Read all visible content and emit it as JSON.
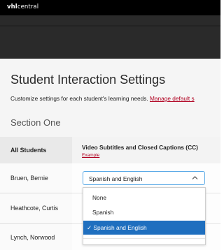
{
  "brand": {
    "bold": "vhl",
    "rest": "central"
  },
  "page": {
    "title": "Student Interaction Settings",
    "subtitle": "Customize settings for each student's learning needs. ",
    "manage_link": "Manage default s",
    "section_title": "Section One"
  },
  "table": {
    "col_all_students": "All Students",
    "col_video": "Video Subtitles and Closed Captions (CC)",
    "example_link": "Example",
    "students": [
      "Bruen, Bernie",
      "Heathcote, Curtis",
      "Lynch, Norwood"
    ]
  },
  "select": {
    "current": "Spanish and English",
    "icon": "chevron-up-icon",
    "options": [
      "None",
      "Spanish",
      "Spanish and English"
    ],
    "check_mark": "✓"
  },
  "colors": {
    "topbar": "#000000",
    "hero": "#2a2a2a",
    "link": "#b00020",
    "focus_border": "#5aa9e6",
    "selected_option": "#1f6fbf"
  }
}
